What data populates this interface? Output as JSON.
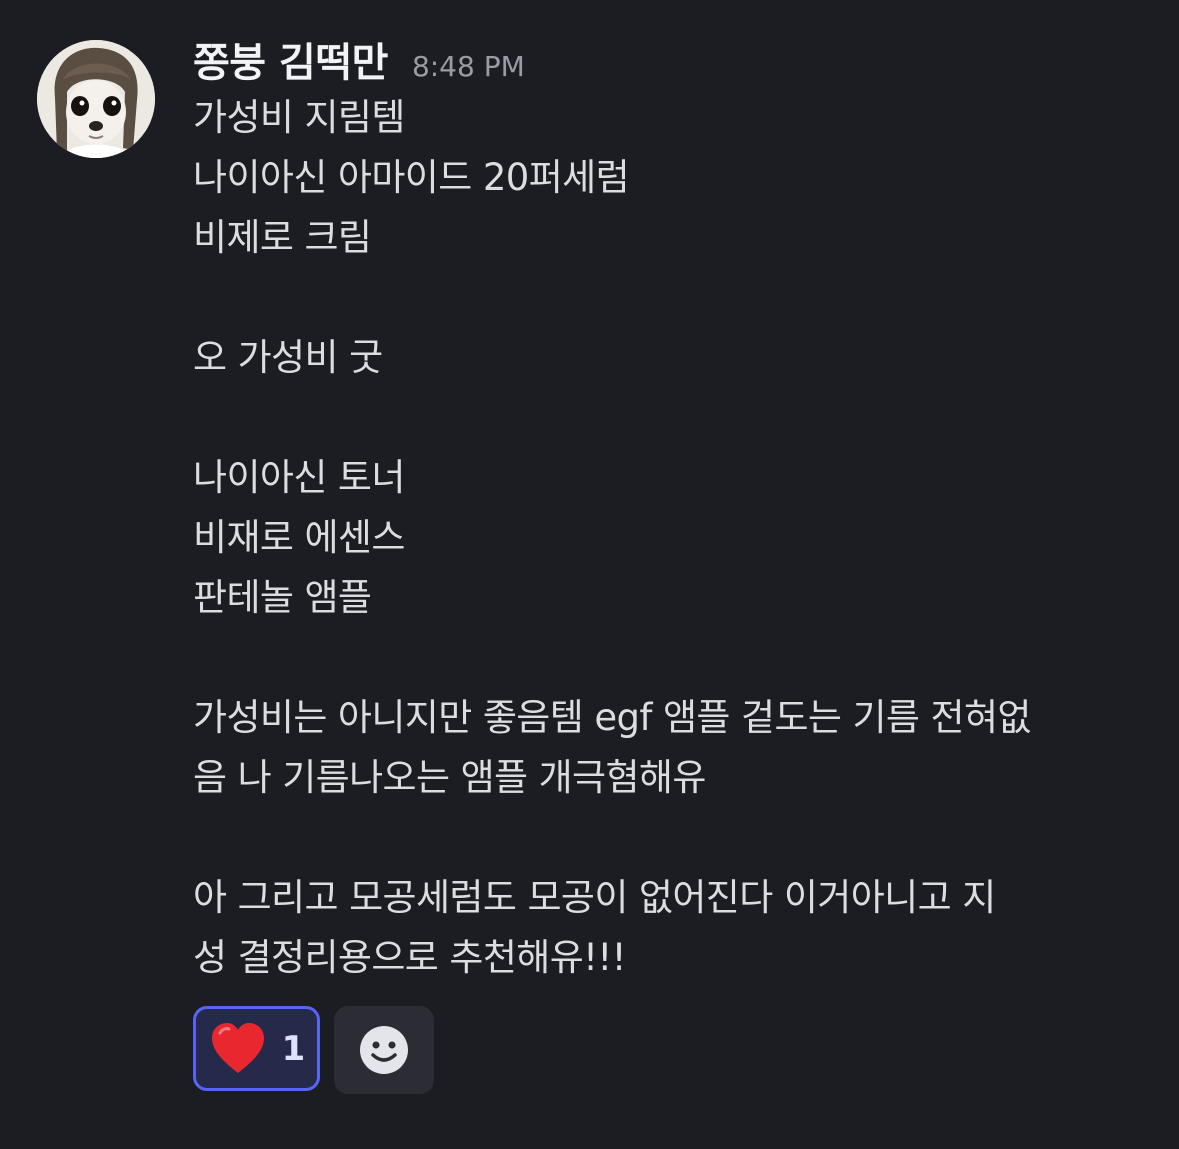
{
  "message": {
    "author": "쫑붕 김떡만",
    "timestamp": "8:48 PM",
    "lines": [
      "가성비 지림템",
      "나이아신 아마이드 20퍼세럼",
      "비제로 크림",
      "",
      "오 가성비 굿",
      "",
      "나이아신 토너",
      "비재로 에센스",
      "판테놀 앰플",
      "",
      "가성비는 아니지만 좋음템 egf 앰플 겉도는 기름 전혀없",
      "음 나 기름나오는 앰플 개극혐해유",
      "",
      "아 그리고 모공세럼도 모공이 없어진다 이거아니고 지",
      "성 결정리용으로 추천해유!!!"
    ]
  },
  "reactions": [
    {
      "emoji": "heart-icon",
      "count": "1",
      "selected": true,
      "color": "#e8272f"
    }
  ],
  "add_reaction": {
    "icon": "smiley-icon"
  },
  "colors": {
    "background": "#1c1d23",
    "reaction_border": "#5865f2",
    "reaction_bg": "#262a4a",
    "add_reaction_bg": "#2c2d34"
  }
}
